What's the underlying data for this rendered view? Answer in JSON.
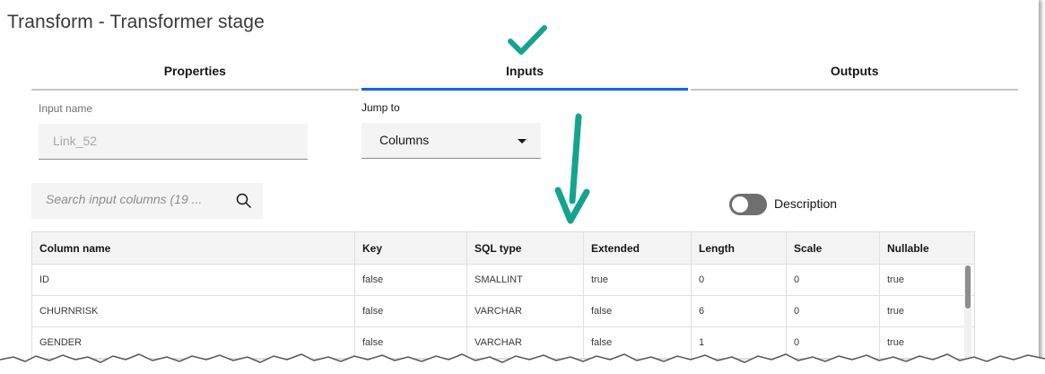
{
  "window": {
    "title": "Transform - Transformer stage"
  },
  "tabs": [
    {
      "label": "Properties"
    },
    {
      "label": "Inputs"
    },
    {
      "label": "Outputs"
    }
  ],
  "active_tab": "Inputs",
  "colors": {
    "accent": "#0f62fe",
    "annotation": "#12a58e",
    "toggle_off": "#6f6f6f"
  },
  "form": {
    "input_name_label": "Input name",
    "input_name_value": "Link_52",
    "jump_to_label": "Jump to",
    "jump_to_value": "Columns"
  },
  "search": {
    "placeholder": "Search input columns (19 ..."
  },
  "toggle": {
    "label": "Description",
    "state": "off"
  },
  "table": {
    "headers": [
      "Column name",
      "Key",
      "SQL type",
      "Extended",
      "Length",
      "Scale",
      "Nullable"
    ],
    "rows": [
      [
        "ID",
        "false",
        "SMALLINT",
        "true",
        "0",
        "0",
        "true"
      ],
      [
        "CHURNRISK",
        "false",
        "VARCHAR",
        "false",
        "6",
        "0",
        "true"
      ],
      [
        "GENDER",
        "false",
        "VARCHAR",
        "false",
        "1",
        "0",
        "true"
      ]
    ]
  },
  "icons": [
    "checkmark-annotation-icon",
    "down-arrow-annotation-icon",
    "search-icon",
    "caret-down-icon",
    "mouse-cursor-icon"
  ]
}
